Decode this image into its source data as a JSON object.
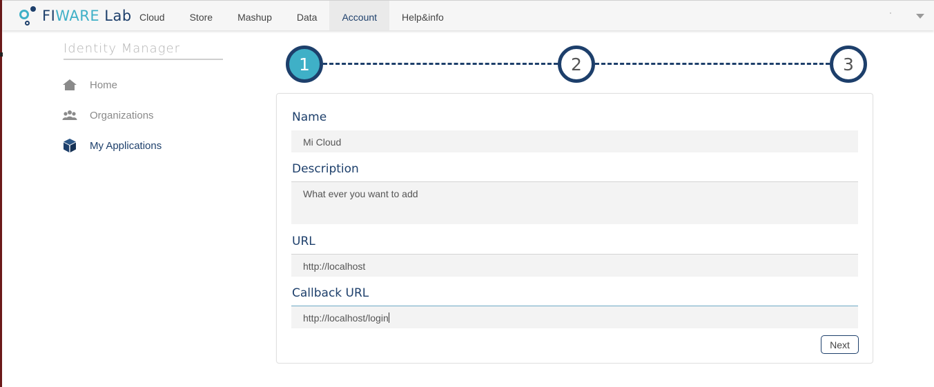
{
  "brand": {
    "text_fi": "FI",
    "text_ware": "WARE",
    "text_lab": " Lab"
  },
  "nav": {
    "tabs": [
      {
        "label": "Cloud"
      },
      {
        "label": "Store"
      },
      {
        "label": "Mashup"
      },
      {
        "label": "Data"
      },
      {
        "label": "Account"
      },
      {
        "label": "Help&info"
      }
    ],
    "active_tab": "Account"
  },
  "sidebar": {
    "title": "Identity Manager",
    "items": [
      {
        "label": "Home",
        "icon": "home-icon"
      },
      {
        "label": "Organizations",
        "icon": "people-group-icon"
      },
      {
        "label": "My Applications",
        "icon": "cube-icon"
      }
    ],
    "active_item": "My Applications"
  },
  "stepper": {
    "steps": [
      {
        "label": "1"
      },
      {
        "label": "2"
      },
      {
        "label": "3"
      }
    ],
    "current_step": 1
  },
  "form": {
    "name_label": "Name",
    "name_value": "Mi Cloud",
    "description_label": "Description",
    "description_value": "What ever you want to add",
    "url_label": "URL",
    "url_value": "http://localhost",
    "callback_label": "Callback URL",
    "callback_value": "http://localhost/login",
    "next_label": "Next"
  },
  "colors": {
    "brand_dark": "#1d3f6b",
    "brand_accent": "#3fb0c7",
    "input_bg": "#f3f3f3",
    "window_edge": "#6b1a1a"
  }
}
